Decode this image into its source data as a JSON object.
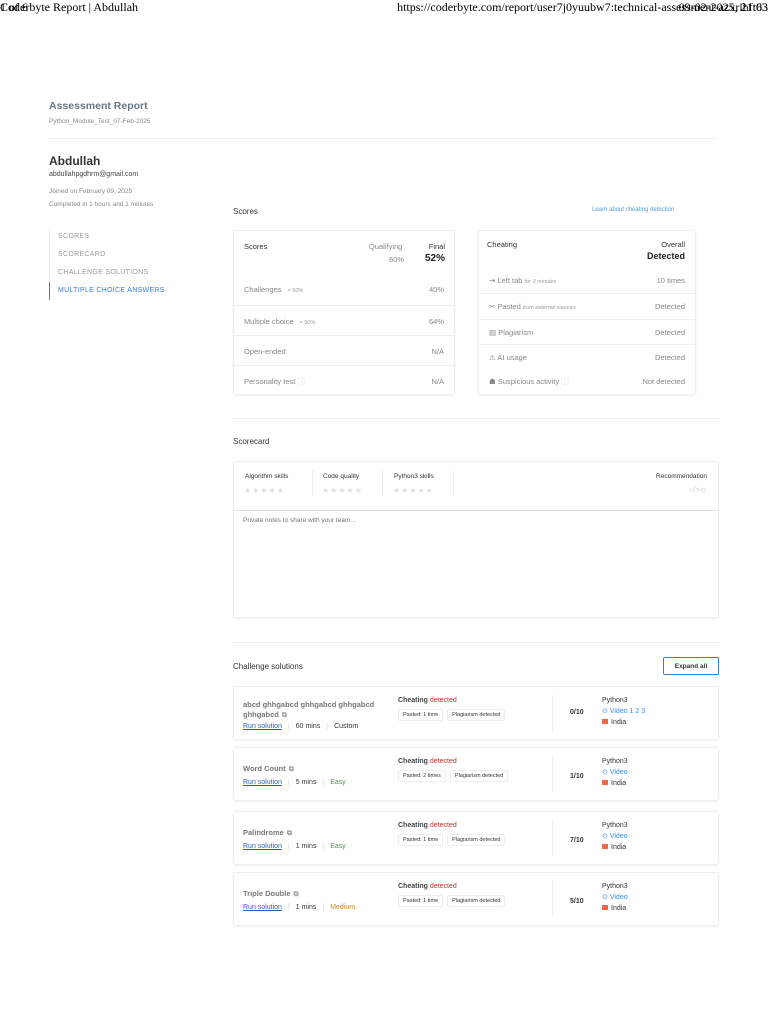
{
  "print": {
    "title": "Coderbyte Report | Abdullah",
    "url": "https://coderbyte.com/report/user7j0yuubw7:technical-assessment-azxrihft63",
    "page": "1 of 6",
    "datetime": "09-02-2025, 21:03"
  },
  "header": {
    "title": "Assessment Report",
    "subtitle": "Python_Module_Test_07-Feb-2025"
  },
  "candidate": {
    "name": "Abdullah",
    "email": "abdullahpgdhrm@gmail.com",
    "joined": "Joined on February 09, 2025",
    "completed": "Completed in 1 hours and 1 minutes"
  },
  "nav": [
    {
      "label": "SCORES"
    },
    {
      "label": "SCORECARD"
    },
    {
      "label": "CHALLENGE SOLUTIONS"
    },
    {
      "label": "MULTIPLE CHOICE ANSWERS"
    }
  ],
  "scores": {
    "heading": "Scores",
    "learn_link": "Learn about cheating detection",
    "card_title": "Scores",
    "qualifying_label": "Qualifying",
    "qualifying_value": "60%",
    "final_label": "Final",
    "final_value": "52%",
    "rows": [
      {
        "label": "Challenges",
        "weight": "× 50%",
        "value": "40%"
      },
      {
        "label": "Multiple choice",
        "weight": "× 50%",
        "value": "64%"
      },
      {
        "label": "Open-ended",
        "weight": "",
        "value": "N/A"
      },
      {
        "label": "Personality test",
        "weight": "",
        "value": "N/A"
      }
    ]
  },
  "cheating": {
    "title": "Cheating",
    "overall_label": "Overall",
    "overall_value": "Detected",
    "rows": [
      {
        "label": "Left tab",
        "note": "for 3 minutes",
        "value": "10 times",
        "icon": "⇥"
      },
      {
        "label": "Pasted",
        "note": "from external sources",
        "value": "Detected",
        "icon": "✂"
      },
      {
        "label": "Plagiarism",
        "note": "",
        "value": "Detected",
        "icon": "▤"
      },
      {
        "label": "AI usage",
        "note": "",
        "value": "Detected",
        "icon": "⚠"
      },
      {
        "label": "Suspicious activity",
        "note": "",
        "value": "Not detected",
        "icon": "☗"
      }
    ]
  },
  "scorecard": {
    "heading": "Scorecard",
    "skills": [
      "Algorithm skills",
      "Code quality",
      "Python3 skills"
    ],
    "recommendation": "Recommendation",
    "notes_placeholder": "Private notes to share with your team..."
  },
  "challenges": {
    "heading": "Challenge solutions",
    "expand_all": "Expand all",
    "cheating_label": "Cheating",
    "detected": "detected",
    "run": "Run solution",
    "items": [
      {
        "title": "abcd ghhgabcd ghhgabcd ghhgabcd ghhgabcd",
        "time": "60 mins",
        "difficulty": "Custom",
        "tags": [
          "Pasted: 1 time",
          "Plagiarism detected"
        ],
        "score": "0/10",
        "lang": "Python3",
        "video": "Video",
        "video_parts": "1  2  3",
        "country": "India"
      },
      {
        "title": "Word Count",
        "time": "5 mins",
        "difficulty": "Easy",
        "tags": [
          "Pasted: 2 times",
          "Plagiarism detected"
        ],
        "score": "1/10",
        "lang": "Python3",
        "video": "Video",
        "video_parts": "",
        "country": "India"
      },
      {
        "title": "Palindrome",
        "time": "1 mins",
        "difficulty": "Easy",
        "tags": [
          "Pasted: 1 time",
          "Plagiarism detected"
        ],
        "score": "7/10",
        "lang": "Python3",
        "video": "Video",
        "video_parts": "",
        "country": "India"
      },
      {
        "title": "Triple Double",
        "time": "1 mins",
        "difficulty": "Medium",
        "tags": [
          "Pasted: 1 time",
          "Plagiarism detected"
        ],
        "score": "5/10",
        "lang": "Python3",
        "video": "Video",
        "video_parts": "",
        "country": "India"
      }
    ]
  },
  "colors": {
    "accent": "#3a7bd5",
    "danger": "#b33333",
    "easy": "#4a9a4a",
    "medium": "#c98a2a"
  }
}
